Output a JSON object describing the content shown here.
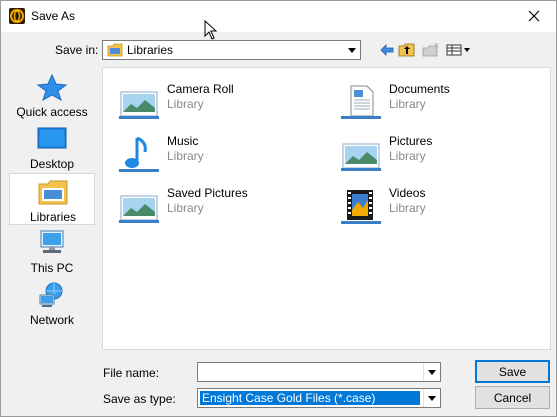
{
  "window": {
    "title": "Save As"
  },
  "save_in": {
    "label": "Save in:",
    "value": "Libraries"
  },
  "toolbar": {
    "back_icon": "back-arrow-icon",
    "up_icon": "up-folder-icon",
    "new_folder_icon": "new-folder-icon",
    "view_icon": "view-menu-icon"
  },
  "places": [
    {
      "label": "Quick access",
      "icon": "quick-access-icon"
    },
    {
      "label": "Desktop",
      "icon": "desktop-icon"
    },
    {
      "label": "Libraries",
      "icon": "libraries-icon",
      "selected": true
    },
    {
      "label": "This PC",
      "icon": "this-pc-icon"
    },
    {
      "label": "Network",
      "icon": "network-icon"
    }
  ],
  "items": [
    {
      "name": "Camera Roll",
      "type": "Library",
      "icon": "picture-library-icon"
    },
    {
      "name": "Documents",
      "type": "Library",
      "icon": "documents-library-icon"
    },
    {
      "name": "Music",
      "type": "Library",
      "icon": "music-library-icon"
    },
    {
      "name": "Pictures",
      "type": "Library",
      "icon": "picture-library-icon"
    },
    {
      "name": "Saved Pictures",
      "type": "Library",
      "icon": "picture-library-icon"
    },
    {
      "name": "Videos",
      "type": "Library",
      "icon": "videos-library-icon"
    }
  ],
  "file_name": {
    "label": "File name:",
    "value": ""
  },
  "save_as_type": {
    "label": "Save as type:",
    "value": "Ensight Case Gold Files (*.case)"
  },
  "buttons": {
    "save": "Save",
    "cancel": "Cancel"
  },
  "colors": {
    "selection": "#0078d7",
    "window_bg": "#f0f0f0"
  }
}
